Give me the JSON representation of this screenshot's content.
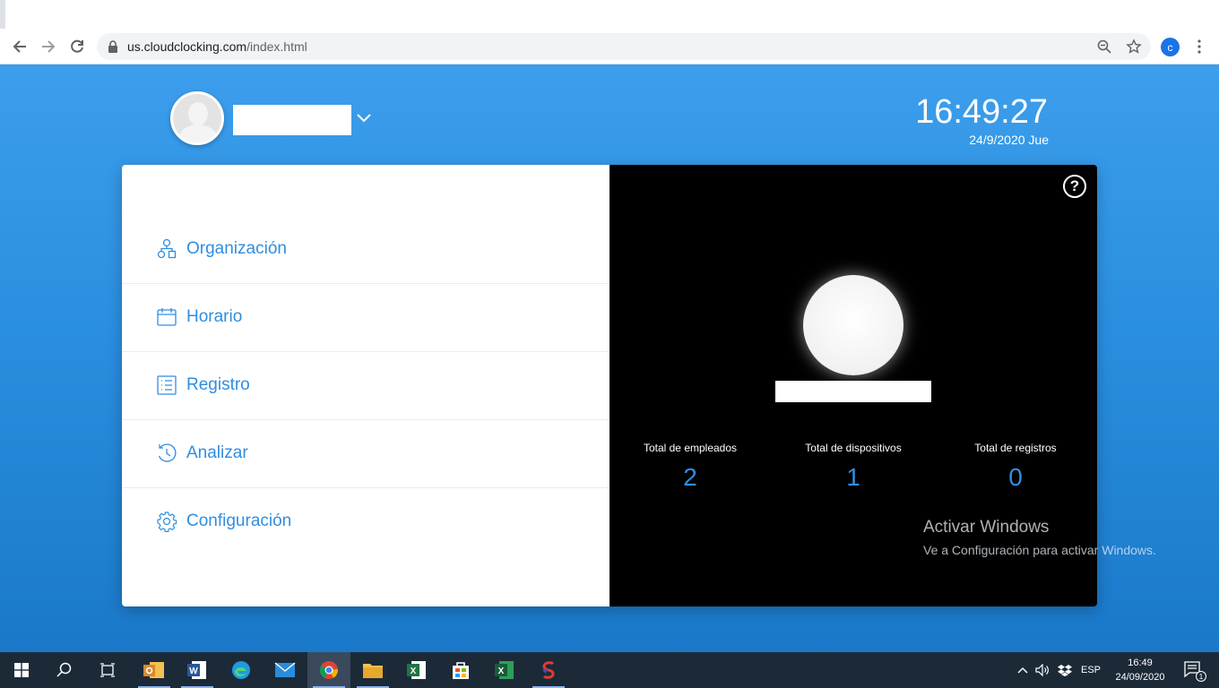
{
  "browser": {
    "url_host": "us.cloudclocking.com",
    "url_path": "/index.html",
    "profile_initial": "c"
  },
  "header": {
    "time": "16:49:27",
    "date": "24/9/2020 Jue"
  },
  "menu": {
    "items": [
      {
        "label": "Organización",
        "icon": "organization-icon"
      },
      {
        "label": "Horario",
        "icon": "calendar-icon"
      },
      {
        "label": "Registro",
        "icon": "list-icon"
      },
      {
        "label": "Analizar",
        "icon": "history-icon"
      },
      {
        "label": "Configuración",
        "icon": "gear-icon"
      }
    ]
  },
  "stats": {
    "help": "?",
    "items": [
      {
        "label": "Total de empleados",
        "value": "2"
      },
      {
        "label": "Total de dispositivos",
        "value": "1"
      },
      {
        "label": "Total de registros",
        "value": "0"
      }
    ]
  },
  "watermark": {
    "title": "Activar Windows",
    "subtitle": "Ve a Configuración para activar Windows."
  },
  "taskbar": {
    "language": "ESP",
    "time": "16:49",
    "date": "24/09/2020",
    "notification_count": "1"
  },
  "colors": {
    "accent": "#2f8ee0",
    "page_bg_top": "#3c9eec",
    "page_bg_bottom": "#1a78c9",
    "stats_bg": "#000000"
  }
}
